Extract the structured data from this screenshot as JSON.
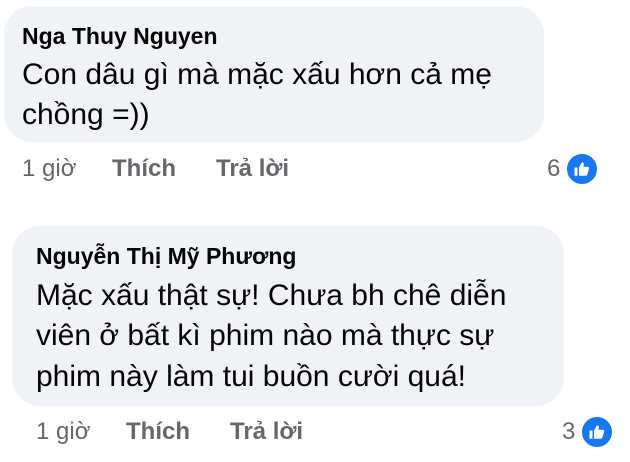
{
  "comments": [
    {
      "author": "Nga Thuy Nguyen",
      "lines": [
        "Con dâu gì mà mặc xấu hơn cả mẹ",
        "chồng =))"
      ],
      "time": "1 giờ",
      "like_label": "Thích",
      "reply_label": "Trả lời",
      "reaction_count": "6",
      "reaction_icon": "like-icon"
    },
    {
      "author": "Nguyễn Thị Mỹ Phương",
      "lines": [
        "Mặc xấu thật sự! Chưa bh chê diễn",
        "viên ở bất kì phim nào mà thực sự",
        "phim này làm tui buồn cười quá!"
      ],
      "time": "1 giờ",
      "like_label": "Thích",
      "reply_label": "Trả lời",
      "reaction_count": "3",
      "reaction_icon": "like-icon"
    }
  ],
  "colors": {
    "bubble_bg": "#f0f2f5",
    "text": "#050505",
    "meta": "#65676b",
    "like_blue": "#1877f2"
  }
}
